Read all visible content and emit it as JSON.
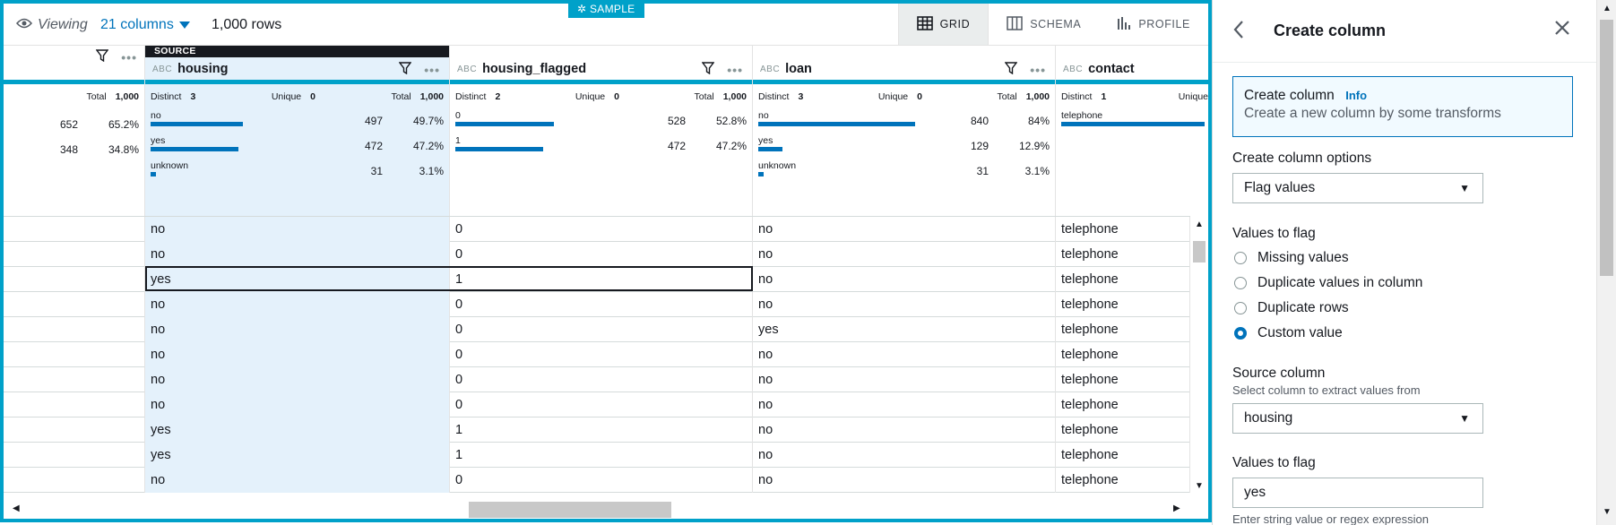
{
  "toolbar": {
    "viewing_label": "Viewing",
    "columns_label": "21 columns",
    "rows_label": "1,000 rows",
    "sample_badge": "SAMPLE",
    "views": [
      {
        "label": "GRID",
        "active": true,
        "icon": "grid-icon"
      },
      {
        "label": "SCHEMA",
        "active": false,
        "icon": "schema-icon"
      },
      {
        "label": "PROFILE",
        "active": false,
        "icon": "profile-icon"
      }
    ]
  },
  "columns": [
    {
      "name": "",
      "type": "",
      "source": false,
      "stats": {
        "distinct_label": "",
        "distinct": "",
        "unique_label": "",
        "unique": "",
        "total_label": "Total",
        "total": "1,000"
      },
      "distribution": [
        {
          "label": "",
          "count": "652",
          "pct": "65.2%",
          "fraction": 0.652
        },
        {
          "label": "",
          "count": "348",
          "pct": "34.8%",
          "fraction": 0.348
        }
      ]
    },
    {
      "name": "housing",
      "type": "ABC",
      "source": true,
      "source_label": "SOURCE",
      "stats": {
        "distinct_label": "Distinct",
        "distinct": "3",
        "unique_label": "Unique",
        "unique": "0",
        "total_label": "Total",
        "total": "1,000"
      },
      "distribution": [
        {
          "label": "no",
          "count": "497",
          "pct": "49.7%",
          "fraction": 0.497
        },
        {
          "label": "yes",
          "count": "472",
          "pct": "47.2%",
          "fraction": 0.472
        },
        {
          "label": "unknown",
          "count": "31",
          "pct": "3.1%",
          "fraction": 0.031
        }
      ]
    },
    {
      "name": "housing_flagged",
      "type": "ABC",
      "source": false,
      "stats": {
        "distinct_label": "Distinct",
        "distinct": "2",
        "unique_label": "Unique",
        "unique": "0",
        "total_label": "Total",
        "total": "1,000"
      },
      "distribution": [
        {
          "label": "0",
          "count": "528",
          "pct": "52.8%",
          "fraction": 0.528
        },
        {
          "label": "1",
          "count": "472",
          "pct": "47.2%",
          "fraction": 0.472
        }
      ]
    },
    {
      "name": "loan",
      "type": "ABC",
      "source": false,
      "stats": {
        "distinct_label": "Distinct",
        "distinct": "3",
        "unique_label": "Unique",
        "unique": "0",
        "total_label": "Total",
        "total": "1,000"
      },
      "distribution": [
        {
          "label": "no",
          "count": "840",
          "pct": "84%",
          "fraction": 0.84
        },
        {
          "label": "yes",
          "count": "129",
          "pct": "12.9%",
          "fraction": 0.129
        },
        {
          "label": "unknown",
          "count": "31",
          "pct": "3.1%",
          "fraction": 0.031
        }
      ]
    },
    {
      "name": "contact",
      "type": "ABC",
      "source": false,
      "stats": {
        "distinct_label": "Distinct",
        "distinct": "1",
        "unique_label": "Unique",
        "unique": "",
        "total_label": "",
        "total": ""
      },
      "distribution": [
        {
          "label": "telephone",
          "count": "",
          "pct": "",
          "fraction": 1.0
        }
      ]
    }
  ],
  "rows": [
    [
      "",
      "no",
      "0",
      "no",
      "telephone"
    ],
    [
      "",
      "no",
      "0",
      "no",
      "telephone"
    ],
    [
      "",
      "yes",
      "1",
      "no",
      "telephone"
    ],
    [
      "",
      "no",
      "0",
      "no",
      "telephone"
    ],
    [
      "",
      "no",
      "0",
      "yes",
      "telephone"
    ],
    [
      "",
      "no",
      "0",
      "no",
      "telephone"
    ],
    [
      "",
      "no",
      "0",
      "no",
      "telephone"
    ],
    [
      "",
      "no",
      "0",
      "no",
      "telephone"
    ],
    [
      "",
      "yes",
      "1",
      "no",
      "telephone"
    ],
    [
      "",
      "yes",
      "1",
      "no",
      "telephone"
    ],
    [
      "",
      "no",
      "0",
      "no",
      "telephone"
    ]
  ],
  "panel": {
    "title": "Create column",
    "info_title": "Create column",
    "info_link": "Info",
    "info_desc": "Create a new column by some transforms",
    "options_label": "Create column options",
    "options_value": "Flag values",
    "values_to_flag_label": "Values to flag",
    "radios": [
      {
        "label": "Missing values",
        "checked": false
      },
      {
        "label": "Duplicate values in column",
        "checked": false
      },
      {
        "label": "Duplicate rows",
        "checked": false
      },
      {
        "label": "Custom value",
        "checked": true
      }
    ],
    "source_column_label": "Source column",
    "source_column_hint": "Select column to extract values from",
    "source_column_value": "housing",
    "flag_values_label": "Values to flag",
    "flag_values_value": "yes",
    "flag_values_hint": "Enter string value or regex expression"
  },
  "colors": {
    "accent": "#00a1c9",
    "bar": "#0073bb",
    "source_bg": "#e4f1fb"
  }
}
